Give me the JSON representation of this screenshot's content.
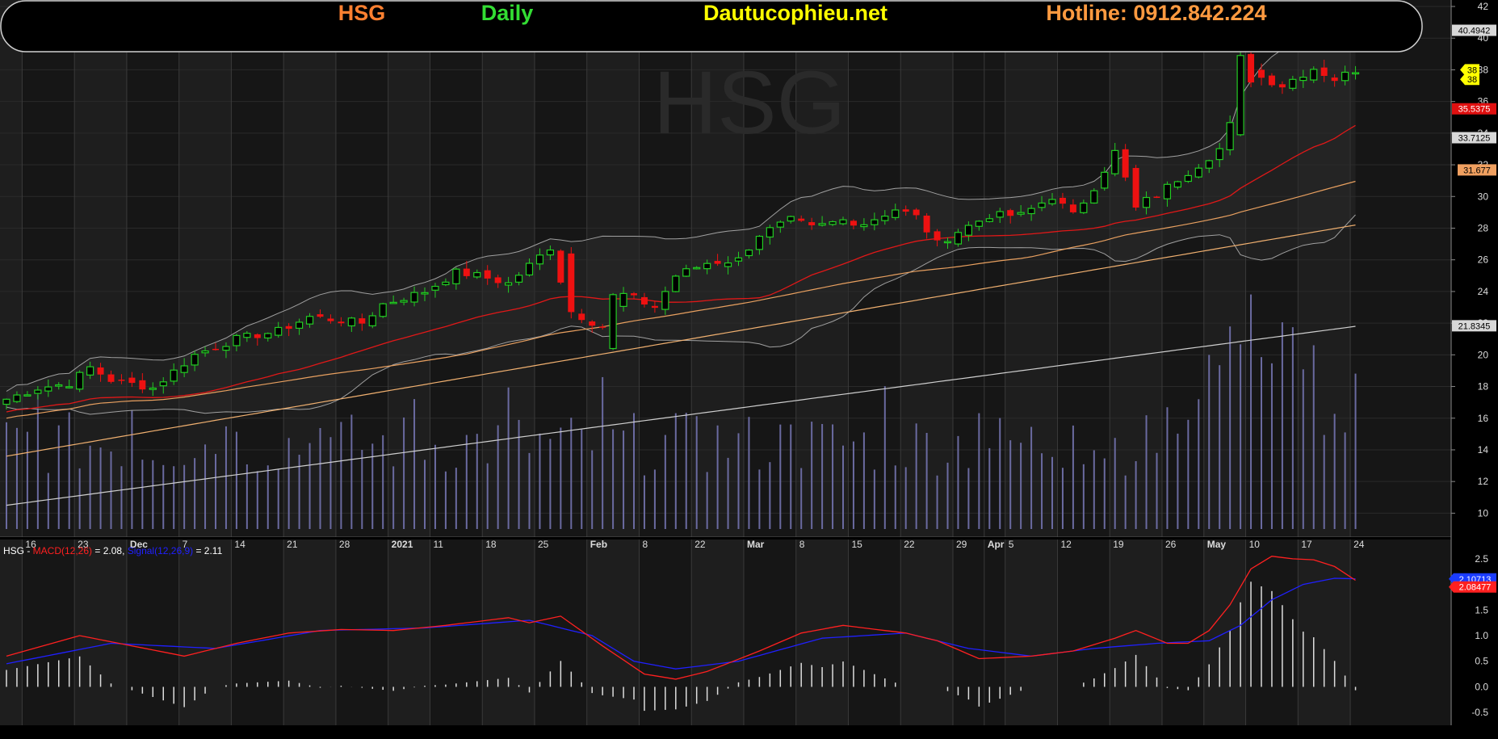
{
  "header": {
    "ticker": "HSG",
    "period": "Daily",
    "site": "Dautucophieu.net",
    "hotline": "Hotline: 0912.842.224",
    "watermark": "HSG"
  },
  "colors": {
    "background": "#000000",
    "band_a": "#161616",
    "band_b": "#1e1e1e",
    "up": "#22cc22",
    "down": "#ee1111",
    "ma_fast": "#e01818",
    "ma_mid": "#e8a060",
    "ma_slow": "#f0b070",
    "ma_long": "#cfcfcf",
    "bollinger": "#a0a0a0",
    "volume": "#6a6aa0",
    "macd": "#ff2020",
    "signal": "#2020ff",
    "hist": "#dddddd",
    "ticker_color": "#ff8030",
    "period_color": "#33dd33",
    "site_color": "#ffff00",
    "hotline_color": "#ff9a40"
  },
  "price_axis": {
    "min": 9,
    "max": 42,
    "ticks": [
      "10",
      "12",
      "14",
      "16",
      "18",
      "20",
      "22",
      "24",
      "26",
      "28",
      "30",
      "32",
      "34",
      "36",
      "38",
      "40",
      "42"
    ],
    "badges": [
      {
        "value": 40.4942,
        "label": "40.4942",
        "bg": "#d8d8d8",
        "fg": "#000000"
      },
      {
        "value": 38,
        "label": "38",
        "bg": "#ffff00",
        "fg": "#000000"
      },
      {
        "value": 37.4,
        "label": "38",
        "bg": "#ffff00",
        "fg": "#000000"
      },
      {
        "value": 35.5375,
        "label": "35.5375",
        "bg": "#e01010",
        "fg": "#ffffff"
      },
      {
        "value": 33.7125,
        "label": "33.7125",
        "bg": "#d8d8d8",
        "fg": "#000000"
      },
      {
        "value": 31.677,
        "label": "31.677",
        "bg": "#f0a060",
        "fg": "#000000"
      },
      {
        "value": 21.8345,
        "label": "21.8345",
        "bg": "#d8d8d8",
        "fg": "#000000"
      }
    ]
  },
  "date_axis": {
    "labels": [
      {
        "i": 2,
        "t": "16",
        "bold": false
      },
      {
        "i": 7,
        "t": "23",
        "bold": false
      },
      {
        "i": 12,
        "t": "Dec",
        "bold": true
      },
      {
        "i": 17,
        "t": "7",
        "bold": false
      },
      {
        "i": 22,
        "t": "14",
        "bold": false
      },
      {
        "i": 27,
        "t": "21",
        "bold": false
      },
      {
        "i": 32,
        "t": "28",
        "bold": false
      },
      {
        "i": 37,
        "t": "2021",
        "bold": true
      },
      {
        "i": 41,
        "t": "11",
        "bold": false
      },
      {
        "i": 46,
        "t": "18",
        "bold": false
      },
      {
        "i": 51,
        "t": "25",
        "bold": false
      },
      {
        "i": 56,
        "t": "Feb",
        "bold": true
      },
      {
        "i": 61,
        "t": "8",
        "bold": false
      },
      {
        "i": 66,
        "t": "22",
        "bold": false
      },
      {
        "i": 71,
        "t": "Mar",
        "bold": true
      },
      {
        "i": 76,
        "t": "8",
        "bold": false
      },
      {
        "i": 81,
        "t": "15",
        "bold": false
      },
      {
        "i": 86,
        "t": "22",
        "bold": false
      },
      {
        "i": 91,
        "t": "29",
        "bold": false
      },
      {
        "i": 94,
        "t": "Apr",
        "bold": true
      },
      {
        "i": 96,
        "t": "5",
        "bold": false
      },
      {
        "i": 101,
        "t": "12",
        "bold": false
      },
      {
        "i": 106,
        "t": "19",
        "bold": false
      },
      {
        "i": 111,
        "t": "26",
        "bold": false
      },
      {
        "i": 115,
        "t": "May",
        "bold": true
      },
      {
        "i": 119,
        "t": "10",
        "bold": false
      },
      {
        "i": 124,
        "t": "17",
        "bold": false
      },
      {
        "i": 129,
        "t": "24",
        "bold": false
      }
    ]
  },
  "macd_panel": {
    "legend_prefix": "HSG - ",
    "macd_label": "MACD(12,26)",
    "macd_value": " = 2.08, ",
    "signal_label": "Signal(12,26,9)",
    "signal_value": " = 2.11",
    "axis_min": -0.75,
    "axis_max": 2.75,
    "ticks": [
      "-0.5",
      "0.0",
      "0.5",
      "1.0",
      "1.5",
      "2.0",
      "2.5"
    ],
    "badges": [
      {
        "value": 2.10713,
        "label": "2.10713",
        "bg": "#1a3cff",
        "fg": "#ffffff"
      },
      {
        "value": 1.95,
        "label": "2.08477",
        "bg": "#ff2020",
        "fg": "#ffffff"
      }
    ]
  },
  "chart_data": {
    "type": "candlestick",
    "title": "HSG Daily",
    "x_axis": "trading days, mid-Nov 2020 to 24 May 2021",
    "y_range": [
      9,
      42
    ],
    "close_anchors": [
      [
        0,
        17.2
      ],
      [
        3,
        17.9
      ],
      [
        6,
        18.2
      ],
      [
        8,
        19.2
      ],
      [
        10,
        18.4
      ],
      [
        14,
        17.9
      ],
      [
        18,
        20.0
      ],
      [
        22,
        21.0
      ],
      [
        26,
        21.5
      ],
      [
        29,
        22.4
      ],
      [
        34,
        22.0
      ],
      [
        36,
        23.2
      ],
      [
        40,
        24.0
      ],
      [
        43,
        25.2
      ],
      [
        45,
        25.0
      ],
      [
        48,
        24.5
      ],
      [
        52,
        26.8
      ],
      [
        54,
        22.6
      ],
      [
        57,
        21.8
      ],
      [
        59,
        23.8
      ],
      [
        62,
        23.0
      ],
      [
        64,
        25.0
      ],
      [
        67,
        25.8
      ],
      [
        70,
        26.0
      ],
      [
        72,
        27.6
      ],
      [
        75,
        28.5
      ],
      [
        77,
        28.0
      ],
      [
        80,
        28.5
      ],
      [
        82,
        28.3
      ],
      [
        85,
        29.2
      ],
      [
        87,
        28.7
      ],
      [
        89,
        27.0
      ],
      [
        91,
        27.8
      ],
      [
        94,
        28.8
      ],
      [
        97,
        28.8
      ],
      [
        100,
        30.0
      ],
      [
        102,
        28.8
      ],
      [
        104,
        30.6
      ],
      [
        106,
        32.8
      ],
      [
        108,
        29.4
      ],
      [
        110,
        30.1
      ],
      [
        112,
        31.1
      ],
      [
        114,
        32.0
      ],
      [
        116,
        33.0
      ],
      [
        117,
        34.5
      ],
      [
        118,
        38.8
      ],
      [
        120,
        37.5
      ],
      [
        122,
        37.0
      ],
      [
        123,
        37.4
      ],
      [
        125,
        38.1
      ],
      [
        127,
        37.4
      ],
      [
        129,
        38.0
      ]
    ],
    "candles_note": "open/high/low derived from closes; 130 daily candles",
    "volume_range": [
      0,
      25
    ],
    "macd_anchors": [
      [
        0,
        0.6
      ],
      [
        7,
        1.0
      ],
      [
        12,
        0.8
      ],
      [
        17,
        0.6
      ],
      [
        22,
        0.85
      ],
      [
        27,
        1.05
      ],
      [
        32,
        1.12
      ],
      [
        37,
        1.1
      ],
      [
        42,
        1.2
      ],
      [
        48,
        1.35
      ],
      [
        50,
        1.25
      ],
      [
        53,
        1.38
      ],
      [
        57,
        0.8
      ],
      [
        61,
        0.25
      ],
      [
        64,
        0.15
      ],
      [
        67,
        0.3
      ],
      [
        72,
        0.7
      ],
      [
        76,
        1.05
      ],
      [
        80,
        1.2
      ],
      [
        86,
        1.05
      ],
      [
        89,
        0.9
      ],
      [
        93,
        0.55
      ],
      [
        98,
        0.6
      ],
      [
        102,
        0.7
      ],
      [
        106,
        0.95
      ],
      [
        108,
        1.1
      ],
      [
        111,
        0.85
      ],
      [
        113,
        0.85
      ],
      [
        115,
        1.1
      ],
      [
        117,
        1.6
      ],
      [
        119,
        2.3
      ],
      [
        121,
        2.55
      ],
      [
        123,
        2.5
      ],
      [
        125,
        2.48
      ],
      [
        127,
        2.35
      ],
      [
        129,
        2.08
      ]
    ],
    "signal_anchors": [
      [
        0,
        0.45
      ],
      [
        10,
        0.85
      ],
      [
        20,
        0.75
      ],
      [
        30,
        1.1
      ],
      [
        40,
        1.15
      ],
      [
        50,
        1.3
      ],
      [
        56,
        1.0
      ],
      [
        60,
        0.5
      ],
      [
        64,
        0.35
      ],
      [
        70,
        0.5
      ],
      [
        78,
        0.95
      ],
      [
        86,
        1.05
      ],
      [
        92,
        0.75
      ],
      [
        98,
        0.6
      ],
      [
        104,
        0.75
      ],
      [
        110,
        0.85
      ],
      [
        115,
        0.9
      ],
      [
        118,
        1.2
      ],
      [
        121,
        1.7
      ],
      [
        124,
        2.0
      ],
      [
        127,
        2.12
      ],
      [
        129,
        2.11
      ]
    ],
    "macd_range": [
      -0.75,
      2.75
    ]
  }
}
